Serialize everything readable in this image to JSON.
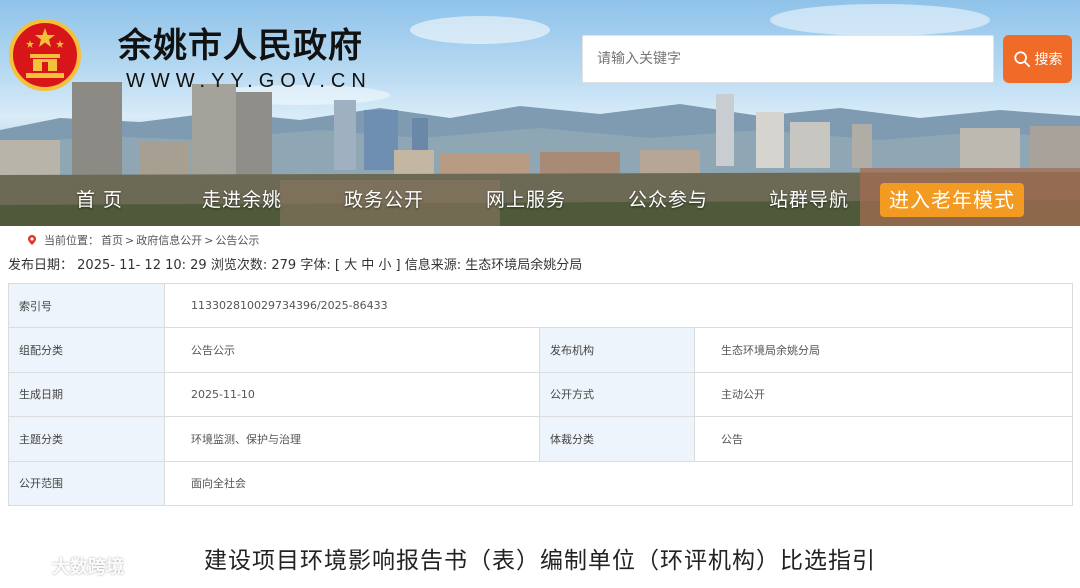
{
  "header": {
    "site_title": "余姚市人民政府",
    "site_url": "WWW.YY.GOV.CN",
    "search_placeholder": "请输入关键字",
    "search_button": "搜索"
  },
  "nav": {
    "items": [
      "首 页",
      "走进余姚",
      "政务公开",
      "网上服务",
      "公众参与",
      "站群导航"
    ],
    "elder_mode": "进入老年模式"
  },
  "breadcrumb": {
    "prefix": "当前位置：",
    "items": [
      "首页",
      "政府信息公开",
      "公告公示"
    ]
  },
  "meta": {
    "publish_label": "发布日期：",
    "publish_date": "2025- 11- 12 10: 29",
    "views_label": "浏览次数:",
    "views": "279",
    "font_label": "字体: [",
    "font_large": "大",
    "font_medium": "中",
    "font_small": "小",
    "source_label": "] 信息来源:",
    "source": "生态环境局余姚分局"
  },
  "info": {
    "index_label": "索引号",
    "index_value": "113302810029734396/2025-86433",
    "category_label": "组配分类",
    "category_value": "公告公示",
    "publisher_label": "发布机构",
    "publisher_value": "生态环境局余姚分局",
    "created_label": "生成日期",
    "created_value": "2025-11-10",
    "method_label": "公开方式",
    "method_value": "主动公开",
    "topic_label": "主题分类",
    "topic_value": "环境监测、保护与治理",
    "genre_label": "体裁分类",
    "genre_value": "公告",
    "scope_label": "公开范围",
    "scope_value": "面向全社会"
  },
  "article": {
    "title": "建设项目环境影响报告书（表）编制单位（环评机构）比选指引"
  },
  "watermark": {
    "text": "大数跨境"
  },
  "colors": {
    "search_button": "#f06a28",
    "elder_button": "#f29a22",
    "label_cell_bg": "#eef4fb"
  }
}
